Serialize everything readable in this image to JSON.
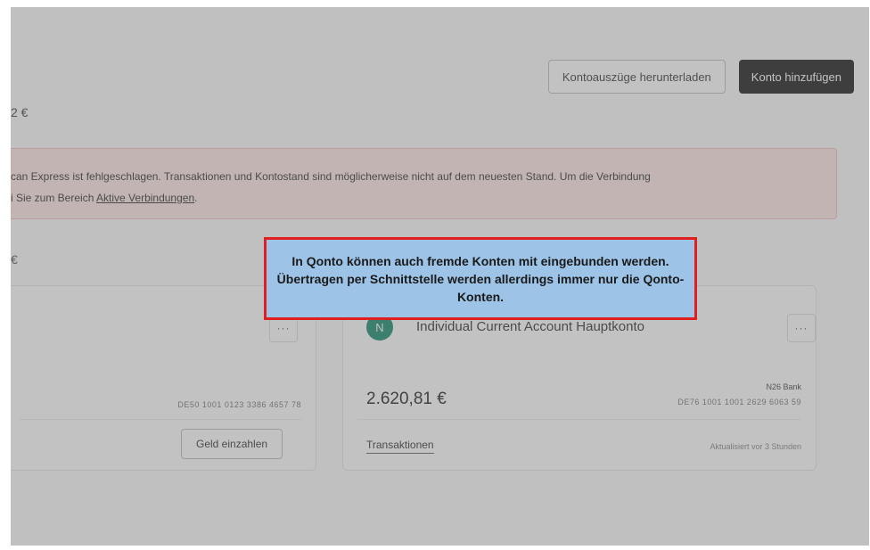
{
  "header": {
    "download_statements_label": "Kontoauszüge herunterladen",
    "add_account_label": "Konto hinzufügen"
  },
  "total_balance": "2 €",
  "alert": {
    "line1": "can Express ist fehlgeschlagen. Transaktionen und Kontostand sind möglicherweise nicht auf dem neuesten Stand. Um die Verbindung",
    "line2_prefix": "i Sie zum Bereich ",
    "link_text": "Aktive Verbindungen",
    "line2_suffix": "."
  },
  "section_sum": "€",
  "accounts": [
    {
      "more_label": "···",
      "iban": "DE50 1001 0123 3386 4657 78",
      "deposit_label": "Geld einzahlen"
    },
    {
      "avatar_letter": "N",
      "name": "Individual Current Account Hauptkonto",
      "more_label": "···",
      "balance": "2.620,81 €",
      "bank": "N26 Bank",
      "iban": "DE76 1001 1001 2629 6063 59",
      "transactions_label": "Transaktionen",
      "updated": "Aktualisiert vor 3 Stunden"
    }
  ],
  "callout": {
    "text": "In Qonto können auch fremde Konten mit eingebunden werden. Übertragen per Schnittstelle werden allerdings immer nur die Qonto-Konten."
  },
  "colors": {
    "callout_bg": "#9dc3e6",
    "callout_border": "#e02020",
    "alert_bg": "#fde7e6",
    "primary_button": "#1d1d1d",
    "avatar_bg": "#1b8c6e"
  }
}
